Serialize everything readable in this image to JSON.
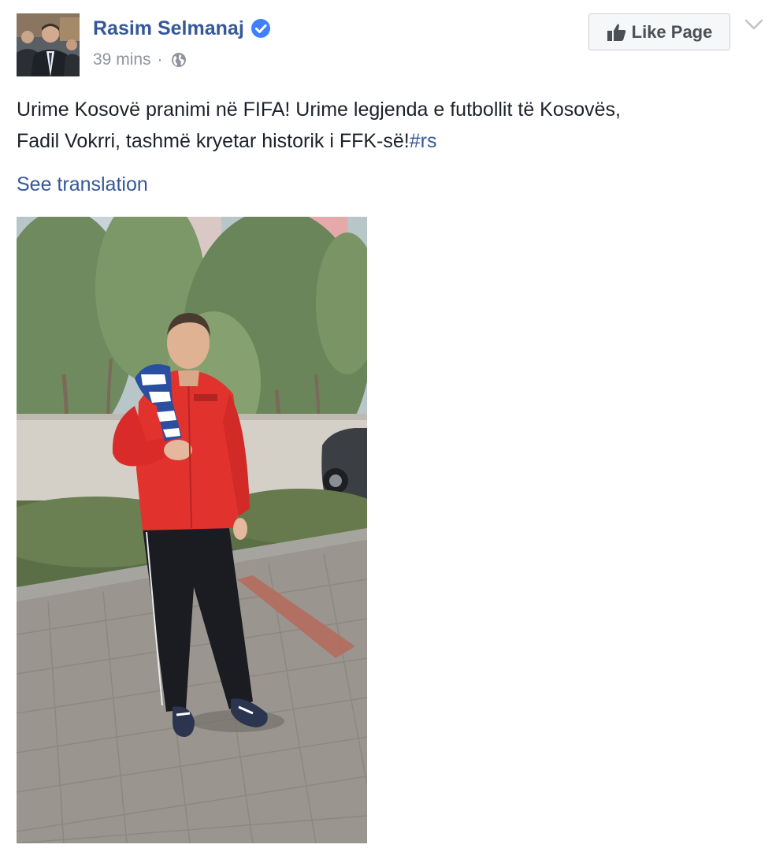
{
  "post": {
    "author": {
      "name": "Rasim Selmanaj",
      "verified": true,
      "verified_icon": "verified-badge-icon"
    },
    "timestamp": "39 mins",
    "separator": "·",
    "audience_icon": "globe-icon",
    "like_page_button": {
      "label": "Like Page",
      "icon": "thumbs-up-icon"
    },
    "options_icon": "chevron-down-icon",
    "text": {
      "line1": "Urime Kosovë pranimi në FIFA! Urime legjenda e futbollit të Kosovës,",
      "line2": "Fadil Vokrri, tashmë kryetar historik i FFK-së!",
      "hashtag": "#rs"
    },
    "see_translation": "See translation"
  },
  "colors": {
    "link": "#365899",
    "meta_text": "#90949c",
    "body_text": "#1d2129",
    "button_bg": "#f6f7f9",
    "button_border": "#ced0d4",
    "verified_badge": "#4080ff"
  }
}
